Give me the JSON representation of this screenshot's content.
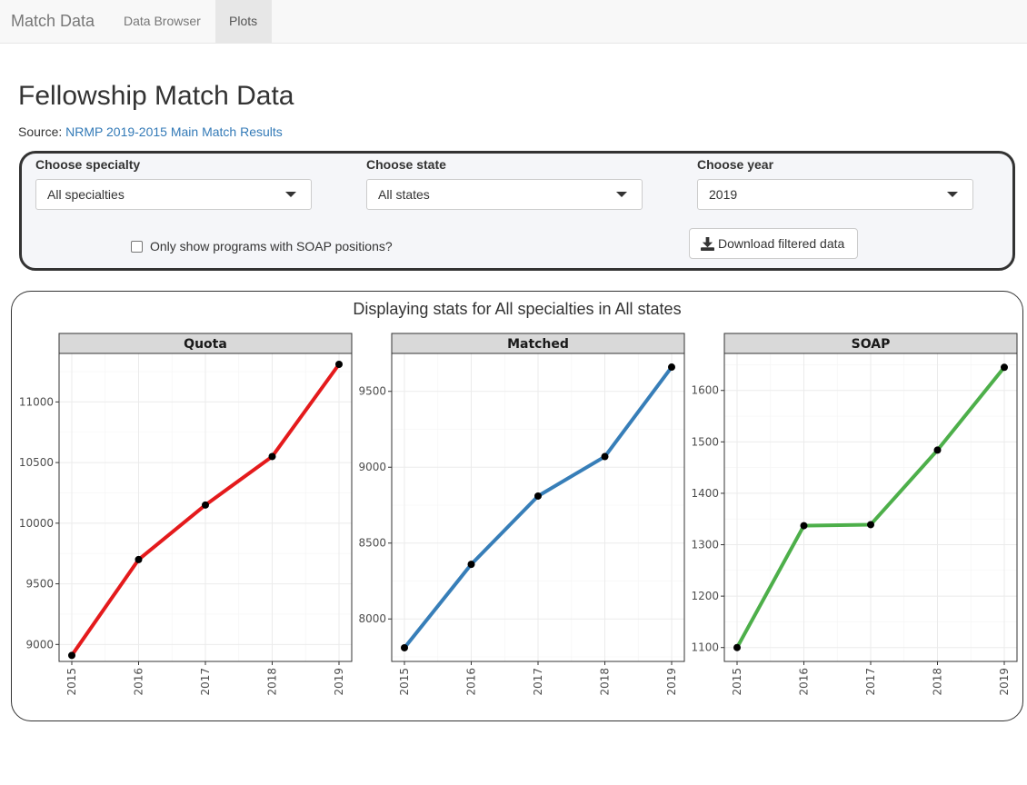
{
  "navbar": {
    "brand": "Match Data",
    "tabs": [
      {
        "label": "Data Browser",
        "active": false
      },
      {
        "label": "Plots",
        "active": true
      }
    ]
  },
  "page": {
    "title": "Fellowship Match Data",
    "source_prefix": "Source:",
    "source_link": "NRMP 2019-2015 Main Match Results"
  },
  "filters": {
    "specialty_label": "Choose specialty",
    "specialty_value": "All specialties",
    "state_label": "Choose state",
    "state_value": "All states",
    "year_label": "Choose year",
    "year_value": "2019",
    "soap_checkbox_label": "Only show programs with SOAP positions?",
    "soap_checked": false,
    "download_label": "Download filtered data"
  },
  "plots": {
    "title": "Displaying stats for All specialties in All states"
  },
  "chart_data": [
    {
      "type": "line",
      "title": "Quota",
      "color": "#e41a1c",
      "x": [
        "2015",
        "2016",
        "2017",
        "2018",
        "2019"
      ],
      "values": [
        8910,
        9700,
        10150,
        10550,
        11310
      ],
      "yticks": [
        9000,
        9500,
        10000,
        10500,
        11000
      ],
      "ylim": [
        8860,
        11400
      ]
    },
    {
      "type": "line",
      "title": "Matched",
      "color": "#377eb8",
      "x": [
        "2015",
        "2016",
        "2017",
        "2018",
        "2019"
      ],
      "values": [
        7810,
        8360,
        8810,
        9070,
        9660
      ],
      "yticks": [
        8000,
        8500,
        9000,
        9500
      ],
      "ylim": [
        7720,
        9750
      ]
    },
    {
      "type": "line",
      "title": "SOAP",
      "color": "#4daf4a",
      "x": [
        "2015",
        "2016",
        "2017",
        "2018",
        "2019"
      ],
      "values": [
        1100,
        1337,
        1339,
        1484,
        1645
      ],
      "yticks": [
        1100,
        1200,
        1300,
        1400,
        1500,
        1600
      ],
      "ylim": [
        1073,
        1672
      ]
    }
  ]
}
